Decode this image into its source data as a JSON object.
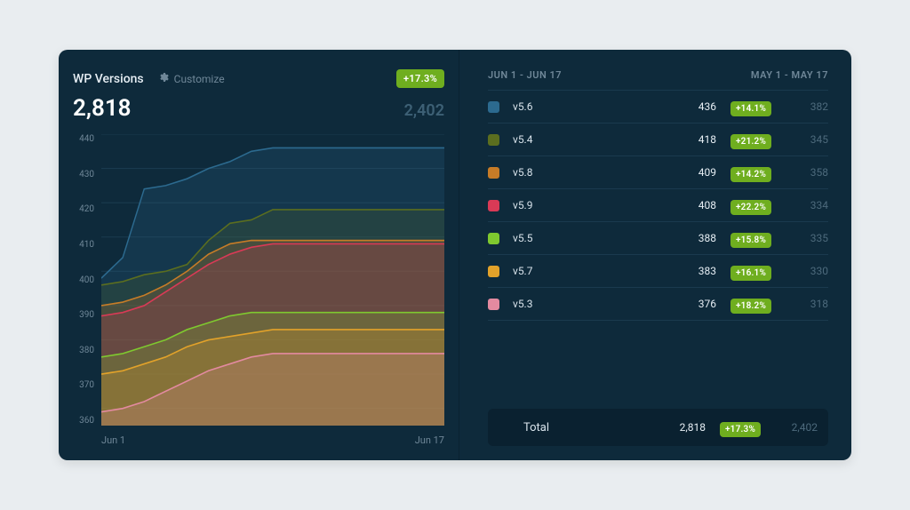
{
  "title": "WP Versions",
  "customize_label": "Customize",
  "overall_change": "+17.3%",
  "primary_total": "2,818",
  "secondary_total": "2,402",
  "date_start": "Jun 1",
  "date_end": "Jun 17",
  "range_primary": "JUN 1 - JUN 17",
  "range_secondary": "MAY 1 - MAY 17",
  "total_label": "Total",
  "y_ticks": [
    "440",
    "430",
    "420",
    "410",
    "400",
    "390",
    "380",
    "370",
    "360"
  ],
  "versions": [
    {
      "name": "v5.6",
      "color": "#2c6a8f",
      "primary": "436",
      "change": "+14.1%",
      "secondary": "382"
    },
    {
      "name": "v5.4",
      "color": "#5b6e1f",
      "primary": "418",
      "change": "+21.2%",
      "secondary": "345"
    },
    {
      "name": "v5.8",
      "color": "#c77c27",
      "primary": "409",
      "change": "+14.2%",
      "secondary": "358"
    },
    {
      "name": "v5.9",
      "color": "#d93a56",
      "primary": "408",
      "change": "+22.2%",
      "secondary": "334"
    },
    {
      "name": "v5.5",
      "color": "#7fc92f",
      "primary": "388",
      "change": "+15.8%",
      "secondary": "335"
    },
    {
      "name": "v5.7",
      "color": "#e2a22a",
      "primary": "383",
      "change": "+16.1%",
      "secondary": "330"
    },
    {
      "name": "v5.3",
      "color": "#e38aa0",
      "primary": "376",
      "change": "+18.2%",
      "secondary": "318"
    }
  ],
  "chart_data": {
    "type": "line",
    "title": "WP Versions",
    "xlabel": "",
    "ylabel": "",
    "ylim": [
      355,
      440
    ],
    "x": [
      1,
      2,
      3,
      4,
      5,
      6,
      7,
      8,
      9,
      10,
      11,
      12,
      13,
      14,
      15,
      16,
      17
    ],
    "x_tick_labels": [
      "Jun 1",
      "",
      "",
      "",
      "",
      "",
      "",
      "",
      "",
      "",
      "",
      "",
      "",
      "",
      "",
      "",
      "Jun 17"
    ],
    "series": [
      {
        "name": "v5.6",
        "color": "#2c6a8f",
        "values": [
          398,
          404,
          424,
          425,
          427,
          430,
          432,
          435,
          436,
          436,
          436,
          436,
          436,
          436,
          436,
          436,
          436
        ]
      },
      {
        "name": "v5.4",
        "color": "#5b6e1f",
        "values": [
          396,
          397,
          399,
          400,
          402,
          409,
          414,
          415,
          418,
          418,
          418,
          418,
          418,
          418,
          418,
          418,
          418
        ]
      },
      {
        "name": "v5.8",
        "color": "#c77c27",
        "values": [
          390,
          391,
          393,
          396,
          400,
          405,
          408,
          409,
          409,
          409,
          409,
          409,
          409,
          409,
          409,
          409,
          409
        ]
      },
      {
        "name": "v5.9",
        "color": "#d93a56",
        "values": [
          387,
          388,
          390,
          394,
          398,
          402,
          405,
          407,
          408,
          408,
          408,
          408,
          408,
          408,
          408,
          408,
          408
        ]
      },
      {
        "name": "v5.5",
        "color": "#7fc92f",
        "values": [
          375,
          376,
          378,
          380,
          383,
          385,
          387,
          388,
          388,
          388,
          388,
          388,
          388,
          388,
          388,
          388,
          388
        ]
      },
      {
        "name": "v5.7",
        "color": "#e2a22a",
        "values": [
          370,
          371,
          373,
          375,
          378,
          380,
          381,
          382,
          383,
          383,
          383,
          383,
          383,
          383,
          383,
          383,
          383
        ]
      },
      {
        "name": "v5.3",
        "color": "#e38aa0",
        "values": [
          359,
          360,
          362,
          365,
          368,
          371,
          373,
          375,
          376,
          376,
          376,
          376,
          376,
          376,
          376,
          376,
          376
        ]
      }
    ]
  }
}
